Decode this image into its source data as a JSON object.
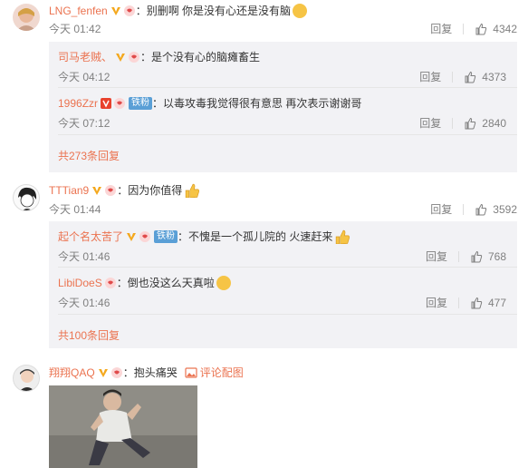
{
  "comments": [
    {
      "user": "LNG_fenfen",
      "text": "：别删啊 你是没有心还是没有脑",
      "time": "今天 01:42",
      "reply_label": "回复",
      "likes": "4342",
      "replies": [
        {
          "user": "司马老贼、",
          "text": "：是个没有心的脑瘫畜生",
          "time": "今天 04:12",
          "reply_label": "回复",
          "likes": "4373"
        },
        {
          "user": "1996Zzr",
          "tag": "铁粉",
          "text": "：以毒攻毒我觉得很有意思 再次表示谢谢哥",
          "time": "今天 07:12",
          "reply_label": "回复",
          "likes": "2840"
        }
      ],
      "more": "共273条回复"
    },
    {
      "user": "TTTian9",
      "text": "：因为你值得",
      "time": "今天 01:44",
      "reply_label": "回复",
      "likes": "3592",
      "replies": [
        {
          "user": "起个名太苦了",
          "tag": "铁粉",
          "text": "：不愧是一个孤儿院的 火速赶来",
          "time": "今天 01:46",
          "reply_label": "回复",
          "likes": "768"
        },
        {
          "user": "LibiDoeS",
          "text": "：倒也没这么天真啦",
          "time": "今天 01:46",
          "reply_label": "回复",
          "likes": "477"
        }
      ],
      "more": "共100条回复"
    },
    {
      "user": "翔翔QAQ",
      "text": "：抱头痛哭",
      "pic_link": "评论配图"
    }
  ],
  "colors": {
    "name": "#eb7350",
    "meta": "#808080",
    "reply_bg": "#f2f2f5",
    "tag": "#5a9fd6"
  }
}
